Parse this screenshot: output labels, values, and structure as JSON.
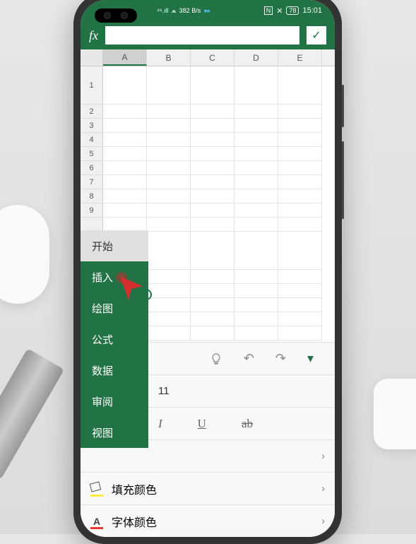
{
  "status": {
    "signal": "⁴⁶.ıll",
    "wifi": "⩕",
    "speed": "382 B/s",
    "nfc": "N",
    "vibrate": "✕",
    "battery": "78",
    "time": "15:01"
  },
  "fx": {
    "label": "fx",
    "check": "✓"
  },
  "columns": [
    "A",
    "B",
    "C",
    "D",
    "E"
  ],
  "rows": [
    "1",
    "2",
    "3",
    "4",
    "5",
    "6",
    "7",
    "8",
    "9",
    ""
  ],
  "tabs": {
    "start": "开始",
    "insert": "插入",
    "draw": "绘图",
    "formula": "公式",
    "data": "数据",
    "review": "审阅",
    "view": "视图"
  },
  "toolbar": {
    "bulb": "💡",
    "undo": "↶",
    "redo": "↷",
    "more": "▾",
    "font_size": "11",
    "italic": "I",
    "underline": "U",
    "strike": "ab",
    "chevron": "›",
    "fill_color": "填充颜色",
    "font_color": "字体颜色",
    "font_a": "A"
  }
}
